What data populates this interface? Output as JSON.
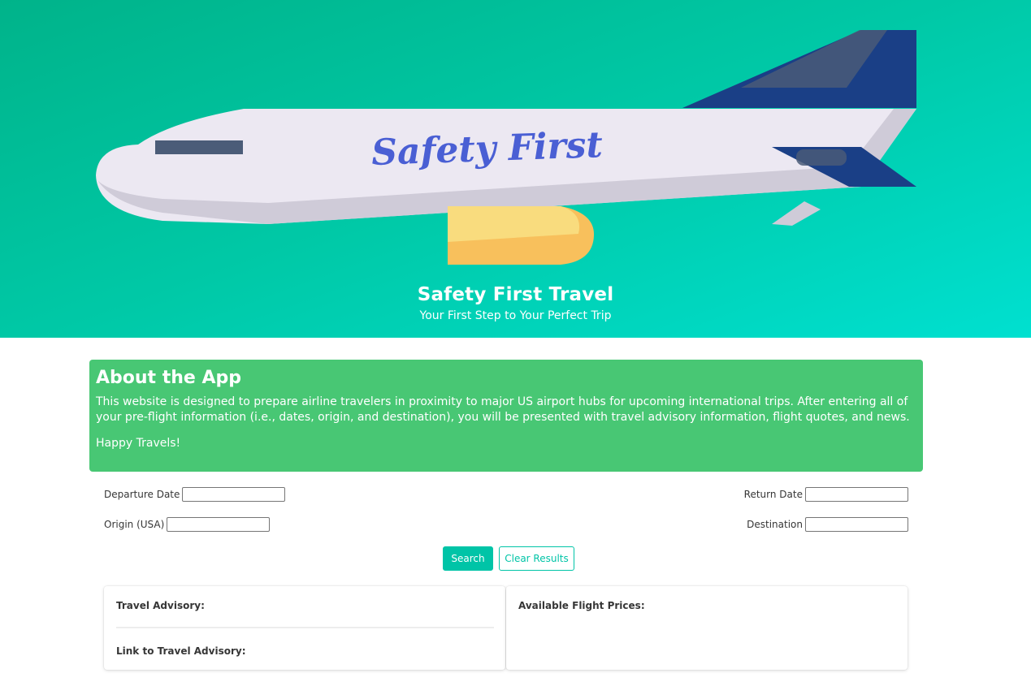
{
  "hero": {
    "logo_text": "Safety First",
    "title": "Safety First Travel",
    "subtitle": "Your First Step to Your Perfect Trip"
  },
  "about": {
    "heading": "About the App",
    "description": "This website is designed to prepare airline travelers in proximity to major US airport hubs for upcoming international trips. After entering all of your pre-flight information (i.e., dates, origin, and destination), you will be presented with travel advisory information, flight quotes, and news.",
    "closing": "Happy Travels!"
  },
  "form": {
    "departure_label": "Departure Date",
    "return_label": "Return Date",
    "origin_label": "Origin (USA)",
    "destination_label": "Destination",
    "departure_value": "",
    "return_value": "",
    "origin_value": "",
    "destination_value": ""
  },
  "buttons": {
    "search": "Search",
    "clear": "Clear Results"
  },
  "results": {
    "advisory_label": "Travel Advisory:",
    "advisory_link_label": "Link to Travel Advisory:",
    "flight_prices_label": "Available Flight Prices:"
  },
  "colors": {
    "hero_gradient_start": "#00b38a",
    "hero_gradient_end": "#00e0d0",
    "about_bg": "#48c774",
    "primary": "#00c4a7"
  }
}
